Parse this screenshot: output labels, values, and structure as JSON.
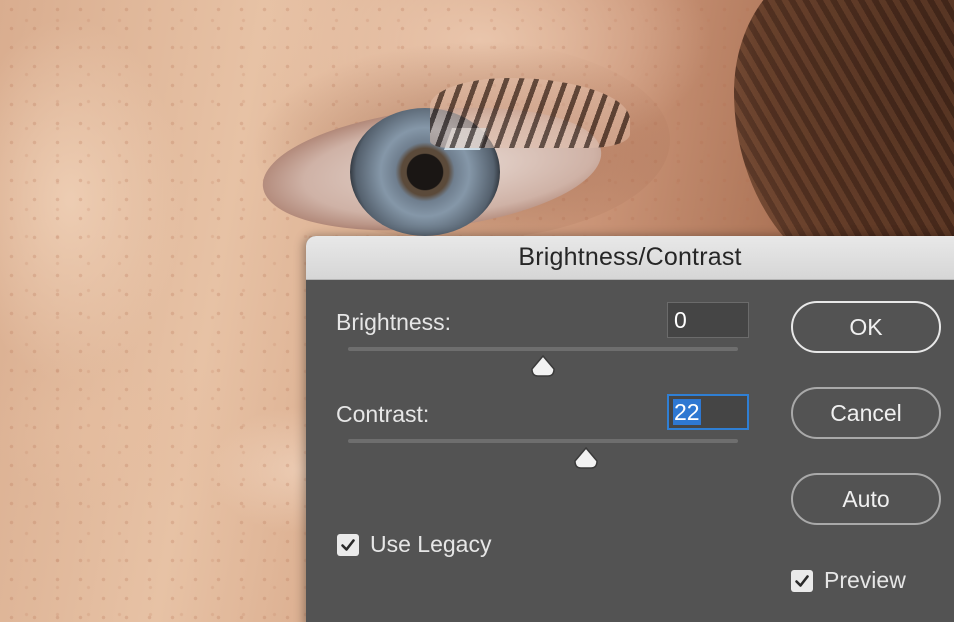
{
  "dialog": {
    "title": "Brightness/Contrast",
    "brightness": {
      "label": "Brightness:",
      "value": "0",
      "slider_fraction": 0.5
    },
    "contrast": {
      "label": "Contrast:",
      "value": "22",
      "selected": true,
      "slider_fraction": 0.61
    },
    "buttons": {
      "ok_label": "OK",
      "cancel_label": "Cancel",
      "auto_label": "Auto"
    },
    "use_legacy": {
      "label": "Use Legacy",
      "checked": true
    },
    "preview": {
      "label": "Preview",
      "checked": true
    }
  },
  "colors": {
    "dialog_bg": "#535353",
    "titlebar_bg": "#d9d9d9",
    "focus_accent": "#2f7fd4",
    "text": "#e6e6e6"
  },
  "icons": {
    "slider_thumb": "triangle-thumb-icon",
    "checkbox": "checkmark-icon"
  }
}
